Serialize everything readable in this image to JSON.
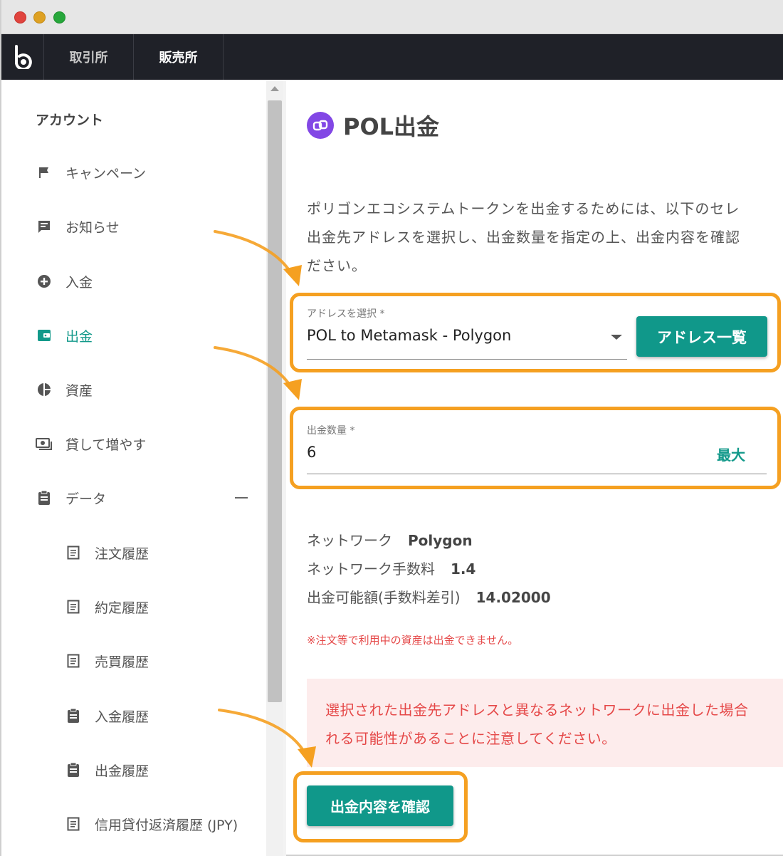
{
  "nav": {
    "tabs": [
      {
        "label": "取引所"
      },
      {
        "label": "販売所"
      }
    ]
  },
  "sidebar": {
    "heading": "アカウント",
    "items": [
      {
        "label": "キャンペーン",
        "icon": "flag-icon"
      },
      {
        "label": "お知らせ",
        "icon": "message-icon"
      },
      {
        "label": "入金",
        "icon": "plus-circle-icon"
      },
      {
        "label": "出金",
        "icon": "wallet-icon",
        "active": true
      },
      {
        "label": "資産",
        "icon": "pie-chart-icon"
      },
      {
        "label": "貸して増やす",
        "icon": "cash-icon"
      },
      {
        "label": "データ",
        "icon": "clipboard-icon"
      }
    ],
    "sub_items": [
      {
        "label": "注文履歴",
        "icon": "document-icon"
      },
      {
        "label": "約定履歴",
        "icon": "document-icon"
      },
      {
        "label": "売買履歴",
        "icon": "document-icon"
      },
      {
        "label": "入金履歴",
        "icon": "clipboard-icon"
      },
      {
        "label": "出金履歴",
        "icon": "clipboard-icon"
      },
      {
        "label": "信用貸付返済履歴 (JPY)",
        "icon": "document-icon"
      }
    ]
  },
  "main": {
    "title": "POL出金",
    "intro_lines": [
      "ポリゴンエコシステムトークンを出金するためには、以下のセレ",
      "出金先アドレスを選択し、出金数量を指定の上、出金内容を確認",
      "ださい。"
    ],
    "address_field": {
      "label": "アドレスを選択 *",
      "value": "POL to Metamask - Polygon",
      "button": "アドレス一覧"
    },
    "amount_field": {
      "label": "出金数量 *",
      "value": "6",
      "max_label": "最大"
    },
    "info": {
      "network_label": "ネットワーク",
      "network_value": "Polygon",
      "fee_label": "ネットワーク手数料",
      "fee_value": "1.4",
      "available_label": "出金可能額(手数料差引)",
      "available_value": "14.02000"
    },
    "note": "※注文等で利用中の資産は出金できません。",
    "warning_lines": [
      "選択された出金先アドレスと異なるネットワークに出金した場合",
      "れる可能性があることに注意してください。"
    ],
    "confirm_button": "出金内容を確認"
  },
  "colors": {
    "accent": "#10988a",
    "highlight": "#f5a021",
    "navbar": "#1f2128",
    "warning": "#e54848",
    "polygon": "#8247e5"
  }
}
